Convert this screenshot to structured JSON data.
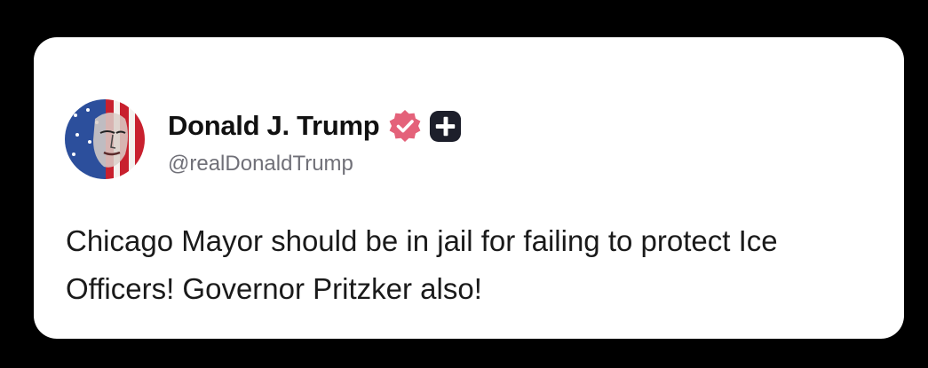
{
  "post": {
    "author": {
      "display_name": "Donald J. Trump",
      "handle": "@realDonaldTrump",
      "avatar_icon": "portrait-avatar",
      "verified_icon": "verified-badge-icon",
      "verified_color": "#e4627a",
      "plus_icon": "plus-badge-icon"
    },
    "text": "Chicago Mayor should be in jail for failing to protect Ice Officers! Governor Pritzker also!"
  },
  "colors": {
    "background": "#000000",
    "card": "#ffffff",
    "text": "#1a1a1a",
    "muted": "#707078"
  }
}
